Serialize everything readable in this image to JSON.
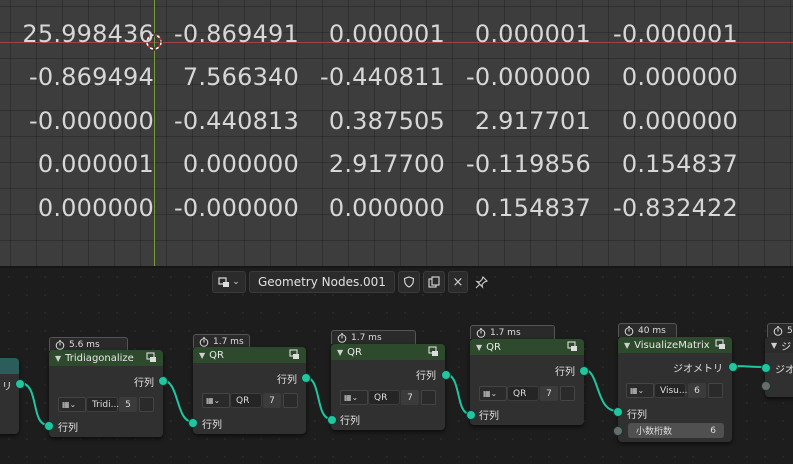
{
  "spreadsheet": {
    "rows": [
      [
        "25.998436",
        "-0.869491",
        "0.000001",
        "0.000001",
        "-0.000001"
      ],
      [
        "-0.869494",
        "7.566340",
        "-0.440811",
        "-0.000000",
        "0.000000"
      ],
      [
        "-0.000000",
        "-0.440813",
        "0.387505",
        "2.917701",
        "0.000000"
      ],
      [
        "0.000001",
        "0.000000",
        "2.917700",
        "-0.119856",
        "0.154837"
      ],
      [
        "0.000000",
        "-0.000000",
        "0.000000",
        "0.154837",
        "-0.832422"
      ]
    ]
  },
  "colors": {
    "viewport_bg": "#3d3d3d",
    "x_axis": "#a3404a",
    "y_axis": "#7a9b3b",
    "node_header": "#2e4a2d",
    "link": "#1fc6a0"
  },
  "node_editor": {
    "tree_name": "Geometry Nodes.001",
    "nodes": [
      {
        "title": "Tridiagonalize",
        "timing": "5.6 ms",
        "output": "行列",
        "field": "Tridi...",
        "num": "5",
        "input": "行列"
      },
      {
        "title": "QR",
        "timing": "1.7 ms",
        "output": "行列",
        "field": "QR",
        "num": "7",
        "input": "行列"
      },
      {
        "title": "QR",
        "timing": "1.7 ms",
        "output": "行列",
        "field": "QR",
        "num": "7",
        "input": "行列"
      },
      {
        "title": "QR",
        "timing": "1.7 ms",
        "output": "行列",
        "field": "QR",
        "num": "7",
        "input": "行列"
      },
      {
        "title": "VisualizeMatrix",
        "timing": "40 ms",
        "output": "ジオメトリ",
        "field": "Visu...",
        "num": "6",
        "input": "行列",
        "prop_label": "小数桁数",
        "prop_value": "6"
      }
    ],
    "left_partial_label": "リ",
    "right_partial_title": "ジ",
    "right_partial_input": "ジオ",
    "right_partial_timing": "5"
  }
}
